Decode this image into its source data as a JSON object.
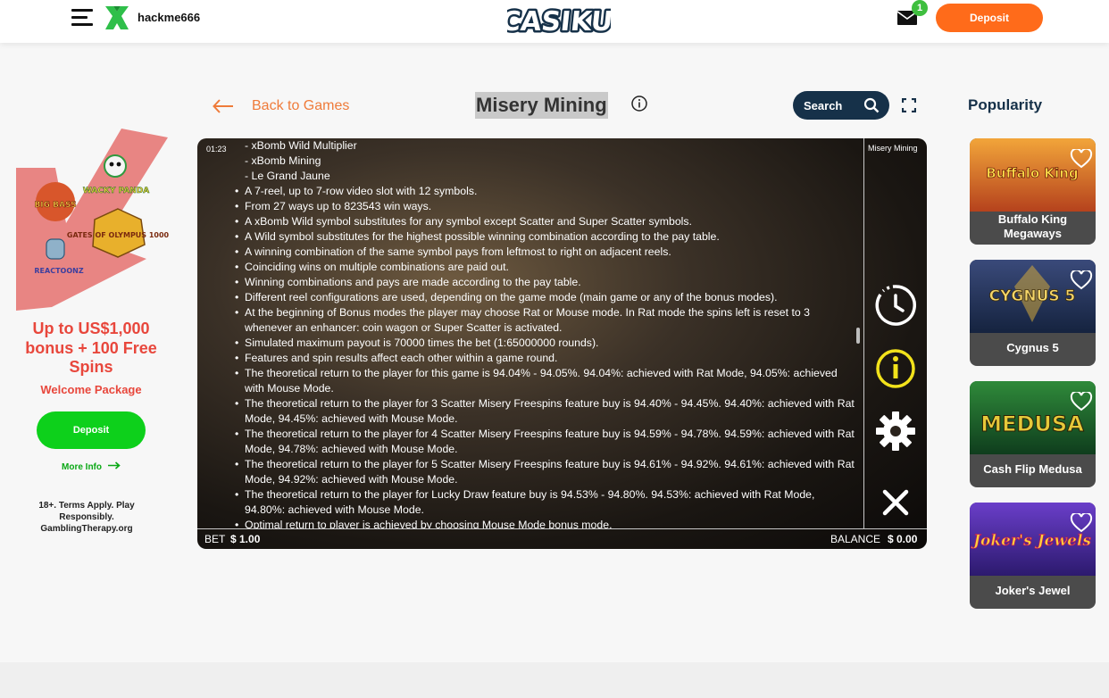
{
  "header": {
    "username": "hackme666",
    "logo_text": "CASIKU",
    "mail_badge": "1",
    "deposit_label": "Deposit"
  },
  "promo": {
    "title": "Up to US$1,000 bonus + 100 Free Spins",
    "subtitle": "Welcome Package",
    "deposit_label": "Deposit",
    "more_info_label": "More Info",
    "disclaimer": "18+. Terms Apply. Play Responsibly. GamblingTherapy.org",
    "art_labels": [
      "BIG BASS",
      "WACKY PANDA",
      "GATES OF OLYMPUS 1000",
      "REACTOONZ"
    ]
  },
  "game_header": {
    "back_label": "Back to Games",
    "title": "Misery Mining",
    "search_label": "Search"
  },
  "game": {
    "clock": "01:23",
    "side_title": "Misery Mining",
    "sub_items": [
      "- xBomb Wild Multiplier",
      "- xBomb Mining",
      "- Le Grand Jaune"
    ],
    "rules": [
      "A 7-reel, up to 7-row video slot with 12 symbols.",
      "From 27 ways up to 823543 win ways.",
      "A xBomb Wild symbol substitutes for any symbol except Scatter and Super Scatter symbols.",
      "A Wild symbol substitutes for the highest possible winning combination according to the pay table.",
      "A winning combination of the same symbol pays from leftmost to right on adjacent reels.",
      "Coinciding wins on multiple combinations are paid out.",
      "Winning combinations and pays are made according to the pay table.",
      "Different reel configurations are used, depending on the game mode (main game or any of the bonus modes).",
      "At the beginning of Bonus modes the player may choose Rat or Mouse mode. In Rat mode the spins left is reset to 3 whenever an enhancer: coin wagon or Super Scatter is activated.",
      "Simulated maximum payout is 70000 times the bet (1:65000000 rounds).",
      "Features and spin results affect each other within a game round.",
      "The theoretical return to the player for this game is 94.04% - 94.05%. 94.04%: achieved with Rat Mode, 94.05%: achieved with Mouse Mode.",
      "The theoretical return to the player for 3 Scatter Misery Freespins feature buy is 94.40% - 94.45%. 94.40%: achieved with Rat Mode, 94.45%: achieved with Mouse Mode.",
      "The theoretical return to the player for 4 Scatter Misery Freespins feature buy is 94.59% - 94.78%. 94.59%: achieved with Rat Mode, 94.78%: achieved with Mouse Mode.",
      "The theoretical return to the player for 5 Scatter Misery Freespins feature buy is 94.61% - 94.92%. 94.61%: achieved with Rat Mode, 94.92%: achieved with Mouse Mode.",
      "The theoretical return to the player for Lucky Draw feature buy is 94.53% - 94.80%. 94.53%: achieved with Rat Mode, 94.80%: achieved with Mouse Mode.",
      "Optimal return to player is achieved by choosing Mouse Mode bonus mode."
    ],
    "bet_label": "BET",
    "bet_value": "$ 1.00",
    "balance_label": "BALANCE",
    "balance_value": "$ 0.00"
  },
  "popularity": {
    "title": "Popularity",
    "cards": [
      {
        "name": "Buffalo King Megaways",
        "thumb_text": "Buffalo King",
        "colors": [
          "#f2a53a",
          "#b5421d"
        ]
      },
      {
        "name": "Cygnus 5",
        "thumb_text": "CYGNUS 5",
        "colors": [
          "#3a4a7a",
          "#15233f"
        ]
      },
      {
        "name": "Cash Flip Medusa",
        "thumb_text": "MEDUSA",
        "colors": [
          "#2f8a3a",
          "#0f3d1d"
        ]
      },
      {
        "name": "Joker's Jewel",
        "thumb_text": "Joker's Jewels",
        "colors": [
          "#6a3ec9",
          "#2c1a6e"
        ]
      }
    ]
  },
  "colors": {
    "brand_orange": "#ff6b1a",
    "promo_red": "#e8473c",
    "promo_green": "#0dd01b",
    "navy": "#163149"
  }
}
